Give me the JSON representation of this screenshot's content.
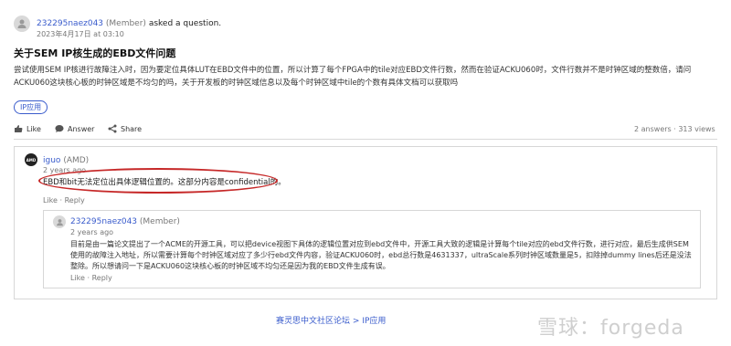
{
  "question": {
    "asker_name": "232295naez043",
    "asker_role": "(Member)",
    "asked_text": "asked a question.",
    "date": "2023年4月17日 at 03:10",
    "title": "关于SEM IP核生成的EBD文件问题",
    "body": "尝试使用SEM IP核进行故障注入时，因为要定位具体LUT在EBD文件中的位置，所以计算了每个FPGA中的tile对应EBD文件行数，然而在验证ACKU060时，文件行数并不是时钟区域的整数倍，请问ACKU060这块核心板的时钟区域是不均匀的吗，关于开发板的时钟区域信息以及每个时钟区域中tile的个数有具体文档可以获取吗",
    "tag": "IP应用",
    "actions": {
      "like": "Like",
      "answer": "Answer",
      "share": "Share"
    },
    "stats": "2 answers · 313 views"
  },
  "answer": {
    "author_name": "iguo",
    "author_role": "(AMD)",
    "time": "2 years ago",
    "text": "EBD和bit无法定位出具体逻辑位置的。这部分内容是confidential的。",
    "actions": "Like · Reply",
    "avatar_label": "AMD"
  },
  "reply": {
    "author_name": "232295naez043",
    "author_role": "(Member)",
    "time": "2 years ago",
    "text": "目前是由一篇论文提出了一个ACME的开源工具，可以把device视图下具体的逻辑位置对应到ebd文件中，开源工具大致的逻辑是计算每个tile对应的ebd文件行数，进行对应，最后生成供SEM使用的故障注入地址，所以需要计算每个时钟区域对应了多少行ebd文件内容，验证ACKU060时，ebd总行数是4631337，ultraScale系列时钟区域数量是5，扣除掉dummy lines后还是没法整除。所以想请问一下是ACKU060这块核心板的时钟区域不均匀还是因为我的EBD文件生成有误。",
    "actions": "Like · Reply"
  },
  "footer": {
    "breadcrumb_home": "赛灵思中文社区论坛",
    "breadcrumb_sep": ">",
    "breadcrumb_leaf": "IP应用"
  },
  "watermark": "雪球：forgeda",
  "colors": {
    "accent": "#3a5ccc",
    "annotation": "#c62828"
  }
}
